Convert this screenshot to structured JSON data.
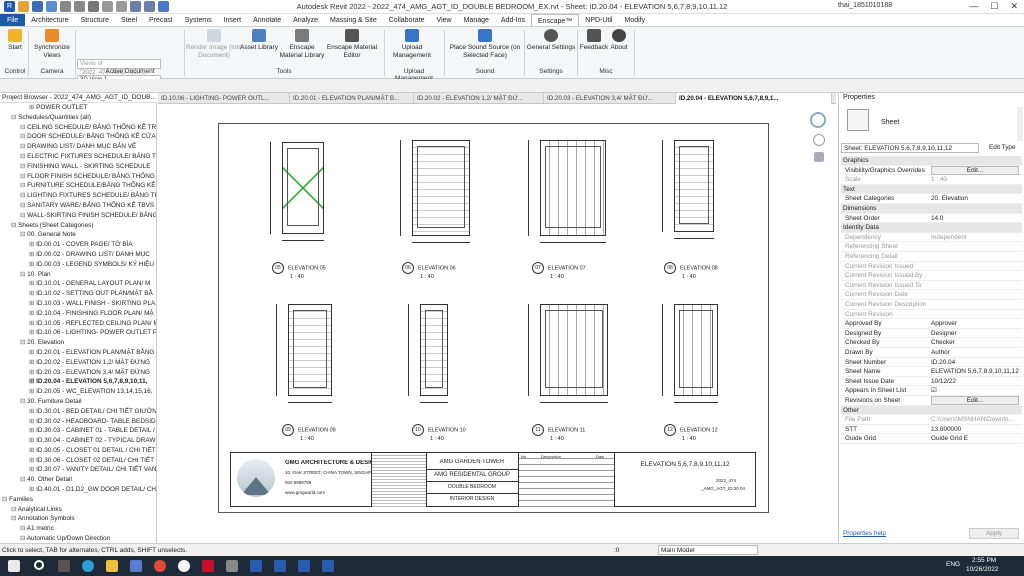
{
  "app": {
    "title": "Autodesk Revit 2022 - 2022_474_AMG_AGT_ID_DOUBLE BEDROOM_EX.rvt - Sheet: ID.20.04 - ELEVATION 5,6,7,8,9,10,11,12",
    "user": "thai_1851010188"
  },
  "menu": [
    "File",
    "Architecture",
    "Structure",
    "Steel",
    "Precast",
    "Systems",
    "Insert",
    "Annotate",
    "Analyze",
    "Massing & Site",
    "Collaborate",
    "View",
    "Manage",
    "Add-Ins",
    "Enscape™",
    "NPD-Util",
    "Modify"
  ],
  "ribbon": {
    "start": "Start",
    "sync": "Synchronize Views",
    "views_placeholder": "Views of \"2022_474_AMG_AGT...",
    "view_value": "3D View 1",
    "render": "Render Image (Into Document)",
    "asset": "Asset Library",
    "material": "Enscape Material Library",
    "editor": "Enscape Material Editor",
    "upload": "Upload Management",
    "sound": "Place Sound Source (on Selected Face)",
    "settings": "General Settings",
    "feedback": "Feedback",
    "about": "About",
    "groups": {
      "control": "Control",
      "camera": "Camera",
      "active": "Active Document",
      "tools": "Tools",
      "uploadm": "Upload Management",
      "soundg": "Sound",
      "settingsg": "Settings",
      "misc": "Misc"
    }
  },
  "browser": {
    "header": "Project Browser - 2022_474_AMG_AGT_ID_DOUB...",
    "items": [
      {
        "t": "POWER OUTLET",
        "l": 3
      },
      {
        "t": "Schedules/Quantities (all)",
        "l": 1
      },
      {
        "t": "CEILING SCHEDULE/ BẢNG THỐNG KÊ TRẦN",
        "l": 2
      },
      {
        "t": "DOOR SCHEDULE/ BẢNG THỐNG KÊ CỬA",
        "l": 2
      },
      {
        "t": "DRAWING LIST/ DANH MỤC BẢN VẼ",
        "l": 2
      },
      {
        "t": "ELECTRIC FIXTURES SCHEDULE/ BẢNG THỐNG",
        "l": 2
      },
      {
        "t": "FINISHING WALL - SKIRTING SCHEDULE",
        "l": 2
      },
      {
        "t": "FLOOR FINISH SCHEDULE/ BẢNG THỐNG KÊ",
        "l": 2
      },
      {
        "t": "FURNITURE SCHEDULE/BẢNG THỐNG KÊ ĐỒ",
        "l": 2
      },
      {
        "t": "LIGHTING FIXTURES SCHEDULE/ BẢNG THỐNG",
        "l": 2
      },
      {
        "t": "SANITARY WARE/ BẢNG THỐNG KÊ TBVS",
        "l": 2
      },
      {
        "t": "WALL-SKIRTING FINISH SCHEDULE/ BẢNG",
        "l": 2
      },
      {
        "t": "Sheets (Sheet Categories)",
        "l": 1
      },
      {
        "t": "00. General Note",
        "l": 2
      },
      {
        "t": "ID.00.01 - COVER PAGE/ TỜ BÌA",
        "l": 3
      },
      {
        "t": "ID.00.02 - DRAWING LIST/ DANH MỤC",
        "l": 3
      },
      {
        "t": "ID.00.03 - LEGEND SYMBOLS/ KÝ HIỆU",
        "l": 3
      },
      {
        "t": "10. Plan",
        "l": 2
      },
      {
        "t": "ID.10.01 - GENERAL LAYOUT PLAN/ M",
        "l": 3
      },
      {
        "t": "ID.10.02 - SETTING OUT PLAN/MẶT BẰ",
        "l": 3
      },
      {
        "t": "ID.10.03 - WALL FINISH - SKIRTING PLA",
        "l": 3
      },
      {
        "t": "ID.10.04 - FINISHING FLOOR PLAN/ MẶ",
        "l": 3
      },
      {
        "t": "ID.10.05 - REFLECTED CEILING PLAN/ M",
        "l": 3
      },
      {
        "t": "ID.10.06 - LIGHTING- POWER OUTLET P",
        "l": 3
      },
      {
        "t": "20. Elevation",
        "l": 2
      },
      {
        "t": "ID.20.01 - ELEVATION PLAN/MẶT BẰNG",
        "l": 3
      },
      {
        "t": "ID.20.02 - ELEVATION 1,2/ MẶT ĐỨNG",
        "l": 3
      },
      {
        "t": "ID.20.03 - ELEVATION 3,4/ MẶT ĐỨNG",
        "l": 3
      },
      {
        "t": "ID.20.04 - ELEVATION 5,6,7,8,9,10,11,",
        "l": 3,
        "sel": true
      },
      {
        "t": "ID.20.05 - WC_ELEVATION 13,14,15,16,",
        "l": 3
      },
      {
        "t": "30. Furniture Detail",
        "l": 2
      },
      {
        "t": "ID.30.01 - BED DETAIL/ CHI TIẾT GIƯỜN",
        "l": 3
      },
      {
        "t": "ID.30.02 - HEADBOARD- TABLE BEDSIDE",
        "l": 3
      },
      {
        "t": "ID.30.03 - CABINET 01 - TABLE DETAIL /",
        "l": 3
      },
      {
        "t": "ID.30.04 - CABINET 02 - TYPICAL DRAW",
        "l": 3
      },
      {
        "t": "ID.30.05 - CLOSET 01 DETAIL / CHI TIẾT",
        "l": 3
      },
      {
        "t": "ID.30.06 - CLOSET 02 DETAIL/ CHI TIẾT",
        "l": 3
      },
      {
        "t": "ID.30.07 - VANITY DETAIL/ CHI TIẾT VAN",
        "l": 3
      },
      {
        "t": "40. Other Detail",
        "l": 2
      },
      {
        "t": "ID.40.01 - D1,D2_GW DOOR DETAIL/ CH",
        "l": 3
      },
      {
        "t": "Families",
        "l": 0
      },
      {
        "t": "Analytical Links",
        "l": 1
      },
      {
        "t": "Annotation Symbols",
        "l": 1
      },
      {
        "t": "A1 metric",
        "l": 2
      },
      {
        "t": "Automatic Up/Down Direction",
        "l": 2
      }
    ]
  },
  "tabs": [
    "ID.10.06 - LIGHTING- POWER OUTL...",
    "ID.20.01 - ELEVATION PLAN/MẶT B...",
    "ID.20.02 - ELEVATION 1,2/ MẶT ĐỨ...",
    "ID.20.03 - ELEVATION 3,4/ MẶT ĐỨ...",
    "ID.20.04 - ELEVATION 5,6,7,8,9,1..."
  ],
  "sheet": {
    "elevations": [
      {
        "num": "05",
        "name": "ELEVATION 05",
        "scale": "1 : 40"
      },
      {
        "num": "06",
        "name": "ELEVATION 06",
        "scale": "1 : 40"
      },
      {
        "num": "07",
        "name": "ELEVATION 07",
        "scale": "1 : 40"
      },
      {
        "num": "08",
        "name": "ELEVATION 08",
        "scale": "1 : 40"
      },
      {
        "num": "09",
        "name": "ELEVATION 09",
        "scale": "1 : 40"
      },
      {
        "num": "10",
        "name": "ELEVATION 10",
        "scale": "1 : 40"
      },
      {
        "num": "11",
        "name": "ELEVATION 11",
        "scale": "1 : 40"
      },
      {
        "num": "12",
        "name": "ELEVATION 12",
        "scale": "1 : 40"
      }
    ],
    "titleblock": {
      "firm": "GMG ARCHITECTURE & DESIGN",
      "address": "10, OAK STREET, CHINA TOWN, SINGAPORE",
      "phone": "000 9998799",
      "email": "www.gmgworld.com",
      "project": "AMG GARDEN TOWER",
      "client": "AMG RESIDENTAL GROUP",
      "room": "DOUBLE BEDROOM",
      "discipline": "INTERIOR DESIGN",
      "sheet_title": "ELEVATION 5,6,7,8,9,10,11,12",
      "no": "No",
      "description": "Description",
      "date": "Date",
      "project_no": "2022_474",
      "sheet_no": "_AMG_AGT_ID.20.04"
    }
  },
  "props": {
    "title": "Properties",
    "type": "Sheet",
    "selector": "Sheet: ELEVATION 5,6,7,8,9,10,11,12",
    "edit_type": "Edit Type",
    "rows": [
      {
        "k": "Graphics",
        "sec": true
      },
      {
        "k": "Visibility/Graphics Overrides",
        "v": "Edit...",
        "btn": true
      },
      {
        "k": "Scale",
        "v": "1 : 40",
        "gray": true
      },
      {
        "k": "Text",
        "sec": true
      },
      {
        "k": "Sheet Categories",
        "v": "20. Elevation"
      },
      {
        "k": "Dimensions",
        "sec": true
      },
      {
        "k": "Sheet Order",
        "v": "14.0"
      },
      {
        "k": "Identity Data",
        "sec": true
      },
      {
        "k": "Dependency",
        "v": "Independent",
        "gray": true
      },
      {
        "k": "Referencing Sheet",
        "v": "",
        "gray": true
      },
      {
        "k": "Referencing Detail",
        "v": "",
        "gray": true
      },
      {
        "k": "Current Revision Issued",
        "v": "",
        "gray": true
      },
      {
        "k": "Current Revision Issued By",
        "v": "",
        "gray": true
      },
      {
        "k": "Current Revision Issued To",
        "v": "",
        "gray": true
      },
      {
        "k": "Current Revision Date",
        "v": "",
        "gray": true
      },
      {
        "k": "Current Revision Description",
        "v": "",
        "gray": true
      },
      {
        "k": "Current Revision",
        "v": "",
        "gray": true
      },
      {
        "k": "Approved By",
        "v": "Approver"
      },
      {
        "k": "Designed By",
        "v": "Designer"
      },
      {
        "k": "Checked By",
        "v": "Checker"
      },
      {
        "k": "Drawn By",
        "v": "Author"
      },
      {
        "k": "Sheet Number",
        "v": "ID.20.04"
      },
      {
        "k": "Sheet Name",
        "v": "ELEVATION 5,6,7,8,9,10,11,12"
      },
      {
        "k": "Sheet Issue Date",
        "v": "10/12/22"
      },
      {
        "k": "Appears In Sheet List",
        "v": "☑"
      },
      {
        "k": "Revisions on Sheet",
        "v": "Edit...",
        "btn": true
      },
      {
        "k": "Other",
        "sec": true
      },
      {
        "k": "File Path",
        "v": "C:\\Users\\MSNHAN\\Downlo...",
        "gray": true
      },
      {
        "k": "STT",
        "v": "13.000000"
      },
      {
        "k": "Guide Grid",
        "v": "Guide Grid E"
      }
    ],
    "help": "Properties help",
    "apply": "Apply"
  },
  "status": {
    "text": "Click to select, TAB for alternates, CTRL adds, SHIFT unselects.",
    "zero": ":0",
    "model": "Main Model"
  },
  "taskbar": {
    "lang": "ENG",
    "time": "2:55 PM",
    "date": "10/26/2022"
  },
  "colors": {
    "file_blue": "#1e5aa8",
    "taskbar": "#1f2a38",
    "revit_blue": "#2a5db0"
  }
}
